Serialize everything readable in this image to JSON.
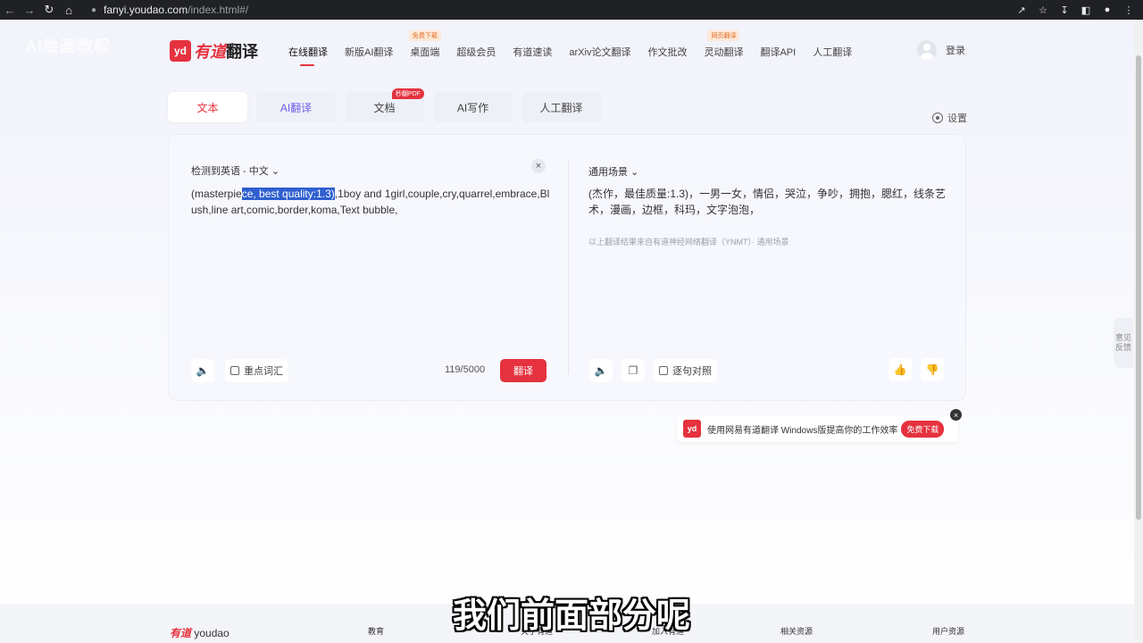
{
  "browser": {
    "url_host": "fanyi.youdao.com",
    "url_path": "/index.html#/"
  },
  "watermark": "AI绘画教程",
  "header": {
    "logo_mark": "yd",
    "brand": "有道",
    "product": "翻译",
    "nav": [
      {
        "label": "在线翻译",
        "tag": ""
      },
      {
        "label": "新版AI翻译",
        "tag": ""
      },
      {
        "label": "桌面端",
        "tag": "免费下载"
      },
      {
        "label": "超级会员",
        "tag": ""
      },
      {
        "label": "有道速读",
        "tag": ""
      },
      {
        "label": "arXiv论文翻译",
        "tag": ""
      },
      {
        "label": "作文批改",
        "tag": ""
      },
      {
        "label": "灵动翻译",
        "tag": "网页翻译"
      },
      {
        "label": "翻译API",
        "tag": ""
      },
      {
        "label": "人工翻译",
        "tag": ""
      }
    ],
    "login": "登录"
  },
  "tabs": [
    {
      "label": "文本",
      "badge": ""
    },
    {
      "label": "AI翻译",
      "badge": ""
    },
    {
      "label": "文档",
      "badge": "秒翻PDF"
    },
    {
      "label": "AI写作",
      "badge": ""
    },
    {
      "label": "人工翻译",
      "badge": ""
    }
  ],
  "settings_label": "设置",
  "source": {
    "lang": "检测到英语 - 中文",
    "text_before": "(masterpie",
    "text_highlight": "ce, best quality:1.3)",
    "text_after": ",1boy and 1girl,couple,cry,quarrel,embrace,Blush,line art,comic,border,koma,Text bubble,",
    "clear": "×",
    "focus_words": "重点词汇",
    "counter": "119/5000",
    "translate": "翻译"
  },
  "target": {
    "lang": "通用场景",
    "text": "(杰作，最佳质量:1.3)，一男一女，情侣，哭泣，争吵，拥抱，腮红，线条艺术，漫画，边框，科玛，文字泡泡，",
    "note": "以上翻译结果来自有道神经网络翻译（YNMT）· 通用场景",
    "compare": "逐句对照"
  },
  "feedback": "意见反馈",
  "promo": {
    "logo": "yd",
    "text": "使用网易有道翻译 Windows版提高你的工作效率",
    "button": "免费下载",
    "close": "×"
  },
  "footer": {
    "logo_a": "有道",
    "logo_b": "youdao",
    "cols": [
      "教育",
      "关于有道",
      "加入有道",
      "相关资源",
      "用户资源"
    ]
  },
  "subtitle": "我们前面部分呢"
}
